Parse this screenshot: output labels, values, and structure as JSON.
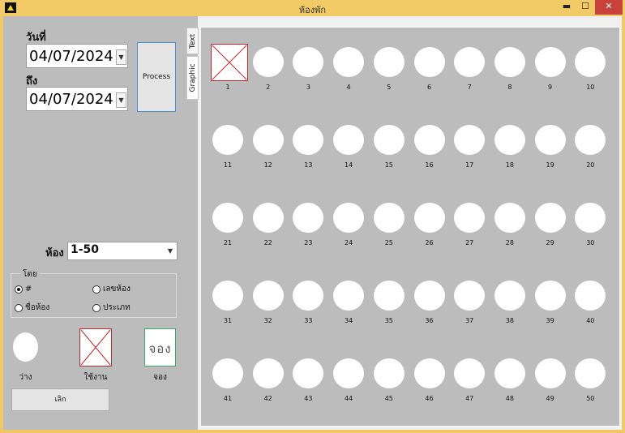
{
  "window": {
    "title": "ห้องพัก",
    "minimize": "▬",
    "maximize": "☐",
    "close": "✕"
  },
  "filters": {
    "from_label": "วันที่",
    "from_value": "04/07/2024",
    "to_label": "ถึง",
    "to_value": "04/07/2024",
    "process_label": "Process",
    "room_label": "ห้อง",
    "room_value": "1-50"
  },
  "sort_group": {
    "legend": "โดย",
    "options": [
      {
        "label": "#",
        "selected": true
      },
      {
        "label": "เลขห้อง",
        "selected": false
      },
      {
        "label": "ชื่อห้อง",
        "selected": false
      },
      {
        "label": "ประเภท",
        "selected": false
      }
    ]
  },
  "legend": {
    "free": "ว่าง",
    "used": "ใช้งาน",
    "reserved": "จอง",
    "reserved_mark": "จอง"
  },
  "cancel_label": "เลิก",
  "tabs": [
    {
      "label": "Text"
    },
    {
      "label": "Graphic"
    }
  ],
  "rooms": [
    {
      "number": "1",
      "status": "used"
    },
    {
      "number": "2",
      "status": "free"
    },
    {
      "number": "3",
      "status": "free"
    },
    {
      "number": "4",
      "status": "free"
    },
    {
      "number": "5",
      "status": "free"
    },
    {
      "number": "6",
      "status": "free"
    },
    {
      "number": "7",
      "status": "free"
    },
    {
      "number": "8",
      "status": "free"
    },
    {
      "number": "9",
      "status": "free"
    },
    {
      "number": "10",
      "status": "free"
    },
    {
      "number": "11",
      "status": "free"
    },
    {
      "number": "12",
      "status": "free"
    },
    {
      "number": "13",
      "status": "free"
    },
    {
      "number": "14",
      "status": "free"
    },
    {
      "number": "15",
      "status": "free"
    },
    {
      "number": "16",
      "status": "free"
    },
    {
      "number": "17",
      "status": "free"
    },
    {
      "number": "18",
      "status": "free"
    },
    {
      "number": "19",
      "status": "free"
    },
    {
      "number": "20",
      "status": "free"
    },
    {
      "number": "21",
      "status": "free"
    },
    {
      "number": "22",
      "status": "free"
    },
    {
      "number": "23",
      "status": "free"
    },
    {
      "number": "24",
      "status": "free"
    },
    {
      "number": "25",
      "status": "free"
    },
    {
      "number": "26",
      "status": "free"
    },
    {
      "number": "27",
      "status": "free"
    },
    {
      "number": "28",
      "status": "free"
    },
    {
      "number": "29",
      "status": "free"
    },
    {
      "number": "30",
      "status": "free"
    },
    {
      "number": "31",
      "status": "free"
    },
    {
      "number": "32",
      "status": "free"
    },
    {
      "number": "33",
      "status": "free"
    },
    {
      "number": "34",
      "status": "free"
    },
    {
      "number": "35",
      "status": "free"
    },
    {
      "number": "36",
      "status": "free"
    },
    {
      "number": "37",
      "status": "free"
    },
    {
      "number": "38",
      "status": "free"
    },
    {
      "number": "39",
      "status": "free"
    },
    {
      "number": "40",
      "status": "free"
    },
    {
      "number": "41",
      "status": "free"
    },
    {
      "number": "42",
      "status": "free"
    },
    {
      "number": "43",
      "status": "free"
    },
    {
      "number": "44",
      "status": "free"
    },
    {
      "number": "45",
      "status": "free"
    },
    {
      "number": "46",
      "status": "free"
    },
    {
      "number": "47",
      "status": "free"
    },
    {
      "number": "48",
      "status": "free"
    },
    {
      "number": "49",
      "status": "free"
    },
    {
      "number": "50",
      "status": "free"
    }
  ],
  "colors": {
    "title_bar": "#f2ca66",
    "panel": "#bcbcbc",
    "used": "#c1272d",
    "reserved": "#3aaa6f",
    "close": "#c8413a"
  }
}
